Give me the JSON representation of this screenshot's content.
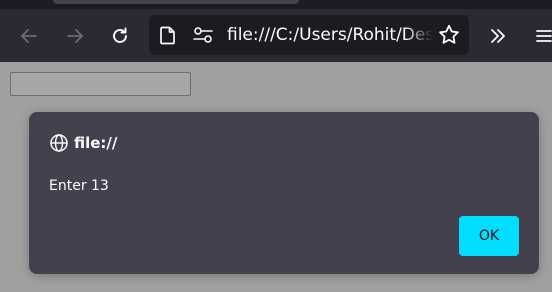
{
  "browser": {
    "back_icon": "arrow-left-icon",
    "forward_icon": "arrow-right-icon",
    "reload_icon": "reload-icon",
    "url": "file:///C:/Users/Rohit/Desktop",
    "overflow_icon": "double-chevron-right-icon",
    "menu_icon": "hamburger-menu-icon"
  },
  "page": {
    "text_input_value": ""
  },
  "dialog": {
    "origin": "file://",
    "message": "Enter 13",
    "ok_label": "OK"
  },
  "colors": {
    "accent": "#00ddff",
    "dialog_bg": "#42414d",
    "toolbar_bg": "#2b2a33",
    "urlbar_bg": "#1c1b22"
  }
}
